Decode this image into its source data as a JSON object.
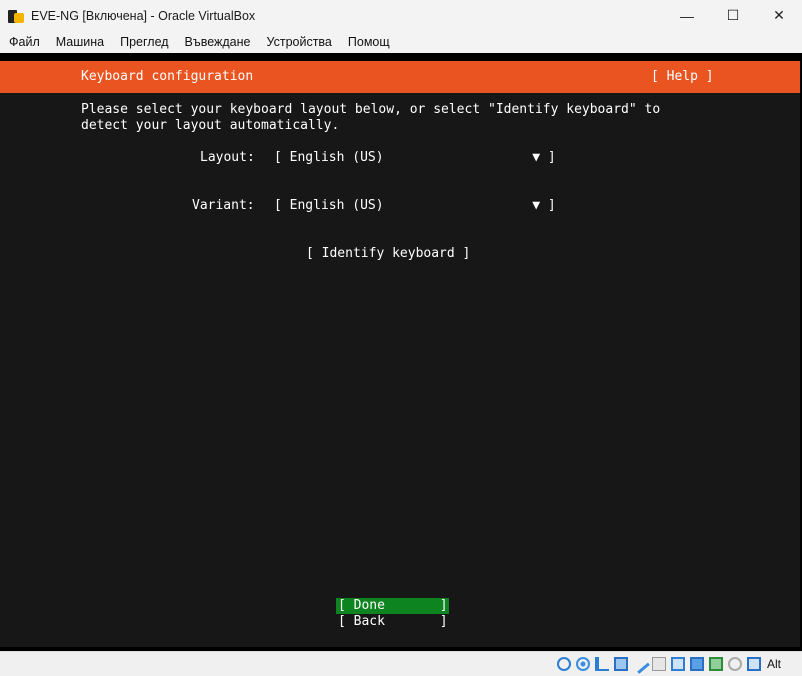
{
  "window": {
    "title": "EVE-NG [Включена] - Oracle VirtualBox",
    "controls": {
      "minimize": "—",
      "maximize": "☐",
      "close": "✕"
    }
  },
  "menu": [
    "Файл",
    "Машина",
    "Преглед",
    "Въвеждане",
    "Устройства",
    "Помощ"
  ],
  "installer": {
    "header_title": "Keyboard configuration",
    "help_label": "[ Help ]",
    "accent_color": "#e95420",
    "intro_line1": "Please select your keyboard layout below, or select \"Identify keyboard\" to",
    "intro_line2": "detect your layout automatically.",
    "layout": {
      "label": "Layout:",
      "value": "[ English (US)                   ▼ ]"
    },
    "variant": {
      "label": "Variant:",
      "value": "[ English (US)                   ▼ ]"
    },
    "identify_button": "[ Identify keyboard ]",
    "done_button": "[ Done       ]",
    "back_button": "[ Back       ]",
    "done_color": "#0e8420"
  },
  "statusbar": {
    "host_key": "Alt",
    "icons": [
      "hard-disk-icon",
      "optical-drive-icon",
      "audio-icon",
      "network-icon",
      "usb-icon",
      "shared-folders-icon",
      "display-icon",
      "screen-capture-icon",
      "cpu-icon",
      "mouse-integration-icon",
      "keyboard-capture-icon"
    ]
  }
}
